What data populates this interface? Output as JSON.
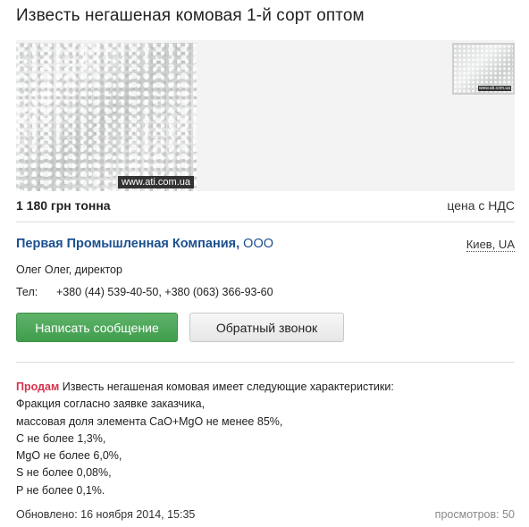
{
  "listing": {
    "title": "Известь негашеная комовая 1-й сорт оптом",
    "watermark_main": "www.ati.com.ua",
    "watermark_thumb": "www.ati.com.ua",
    "price": "1 180 грн тонна",
    "price_note": "цена с НДС"
  },
  "seller": {
    "company_name": "Первая Промышленная Компания,",
    "company_type": "ООО",
    "location": "Киев, UA",
    "contact_person": "Олег Олег, директор",
    "phone_label": "Тел:",
    "phones": "+380 (44) 539-40-50, +380 (063) 366-93-60"
  },
  "actions": {
    "message_label": "Написать сообщение",
    "callback_label": "Обратный звонок"
  },
  "description": {
    "tag": "Продам",
    "intro": " Известь негашеная комовая имеет следующие характеристики:",
    "lines": [
      "Фракция согласно заявке заказчика,",
      "массовая доля элемента CaO+MgO не менее 85%,",
      "С не более 1,3%,",
      "MgO не более 6,0%,",
      "S не более 0,08%,",
      "P не более 0,1%."
    ]
  },
  "footer": {
    "updated": "Обновлено: 16 ноября 2014, 15:35",
    "views": "просмотров: 50"
  },
  "colors": {
    "company_link": "#1b4f8f",
    "sell_tag": "#d6324e",
    "primary_button": "#4aa556"
  }
}
